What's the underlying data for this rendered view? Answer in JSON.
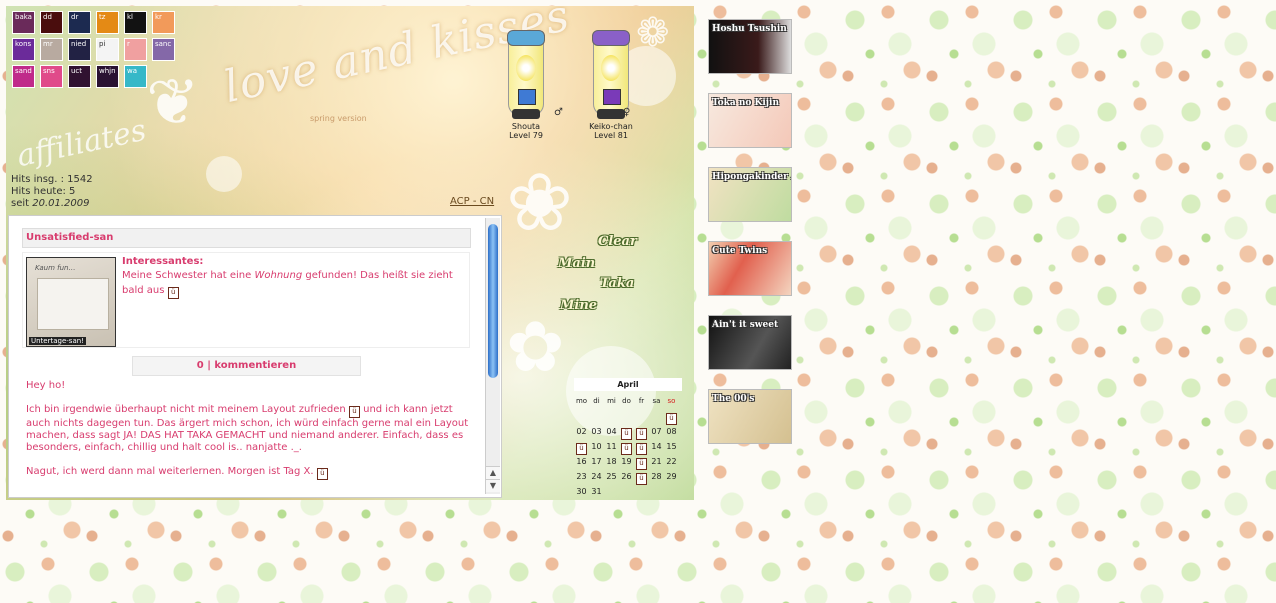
{
  "header": {
    "logo": "love and kisses",
    "logo_sub": "spring version",
    "affiliates_title": "affiliates"
  },
  "aff_buttons": [
    "baka",
    "dd",
    "dr",
    "tz",
    "kl",
    "kr",
    "kons",
    "mr",
    "nied",
    "pi",
    "r",
    "sanc",
    "sand",
    "sns",
    "uct",
    "whjn",
    "wa"
  ],
  "aff_colors": [
    "#6a2a5a",
    "#4a0d0d",
    "#1c2a50",
    "#e48a15",
    "#121212",
    "#f29a5a",
    "#6b2b9a",
    "#b8aaa0",
    "#222244",
    "#f4f4f4",
    "#f0a0a0",
    "#8468a8",
    "#c02a8a",
    "#e04a8a",
    "#301230",
    "#2a1232",
    "#36b8c8"
  ],
  "stats": {
    "hits_total": "Hits insg. : 1542",
    "hits_today": "Hits heute: 5",
    "since_label": "seit",
    "since_date": "20.01.2009"
  },
  "acp_link": "ACP - CN",
  "pets": [
    {
      "name": "Shouta",
      "level": "Level 79",
      "gender": "♂",
      "cap_color": "#5aa8d8",
      "gem_color": "#3f7ad4"
    },
    {
      "name": "Keiko-chan",
      "level": "Level 81",
      "gender": "♀",
      "cap_color": "#8a60c8",
      "gem_color": "#7a3ab8"
    }
  ],
  "nav": [
    "Clear",
    "Main",
    "Taka",
    "Mine"
  ],
  "entry": {
    "title": "Unsatisfied-san",
    "image_caption": "Untertage-san!",
    "image_hand": "Kaum fun…",
    "interessantes_title": "Interessantes:",
    "interessantes_pre": "Meine Schwester hat eine",
    "interessantes_em": "Wohnung",
    "interessantes_post": "gefunden! Das heißt sie zieht bald aus",
    "comments": "0 | kommentieren",
    "greeting": "Hey ho!",
    "para1_a": "Ich bin irgendwie überhaupt nicht mit meinem Layout zufrieden",
    "para1_b": "und ich kann jetzt auch nichts dagegen tun. Das ärgert mich schon, ich würd einfach gerne mal ein Layout machen, dass sagt JA! DAS HAT TAKA GEMACHT und niemand anderer. Einfach, dass es besonders, einfach, chillig und halt cool is.. nanjatte ._.",
    "para2": "Nagut, ich werd dann mal weiterlernen. Morgen ist Tag X."
  },
  "smiley_glyph": "ü",
  "scroll": {
    "up": "▲",
    "down": "▼"
  },
  "calendar": {
    "month": "April",
    "weekdays": [
      "mo",
      "di",
      "mi",
      "do",
      "fr",
      "sa",
      "so"
    ],
    "days": [
      "",
      "",
      "",
      "",
      "",
      "",
      "01",
      "02",
      "03",
      "04",
      "05",
      "06",
      "07",
      "08",
      "09",
      "10",
      "11",
      "12",
      "13",
      "14",
      "15",
      "16",
      "17",
      "18",
      "19",
      "20",
      "21",
      "22",
      "23",
      "24",
      "25",
      "26",
      "27",
      "28",
      "29",
      "30",
      "31",
      "",
      ""
    ],
    "marked": [
      "01",
      "05",
      "06",
      "09",
      "12",
      "13",
      "20",
      "27"
    ]
  },
  "affiliate_banners": [
    {
      "label": "Hoshu Tsushin",
      "bg": "linear-gradient(90deg,#111,#3a1a1a 60%,#ddd)"
    },
    {
      "label": "Toka no Kijin",
      "bg": "linear-gradient(120deg,#f7e9df,#f4c8b8)"
    },
    {
      "label": "Hipongakinder Aktion",
      "bg": "linear-gradient(120deg,#f1e2c2,#bfdca0)"
    },
    {
      "label": "Cute Twins",
      "bg": "linear-gradient(120deg,#f2cfb0,#e1604e 40%,#f4d5c0)"
    },
    {
      "label": "Ain't it sweet",
      "bg": "linear-gradient(120deg,#111,#555 60%,#222)"
    },
    {
      "label": "The 00's",
      "bg": "linear-gradient(120deg,#efe2c2,#d4c090)"
    }
  ]
}
